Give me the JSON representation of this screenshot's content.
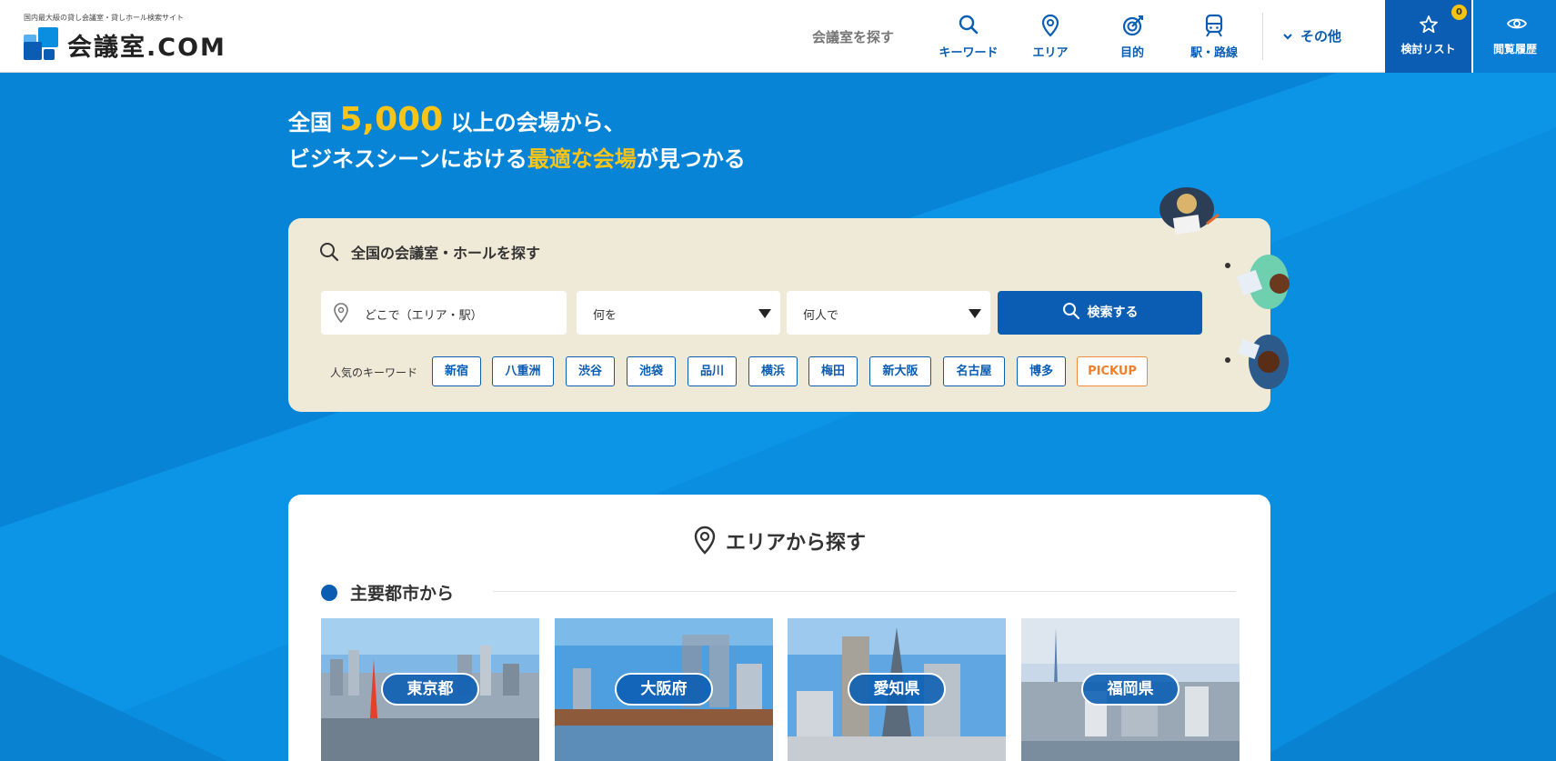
{
  "header": {
    "tagline": "国内最大級の貸し会議室・貸しホール検索サイト",
    "logo_text": "会議室.COM",
    "find_label": "会議室を探す",
    "nav": [
      {
        "label": "キーワード",
        "icon": "search-icon"
      },
      {
        "label": "エリア",
        "icon": "map-pin-icon"
      },
      {
        "label": "目的",
        "icon": "target-icon"
      },
      {
        "label": "駅・路線",
        "icon": "train-icon"
      }
    ],
    "other_label": "その他",
    "favorites_label": "検討リスト",
    "favorites_count": "0",
    "history_label": "閲覧履歴"
  },
  "hero": {
    "line1_prefix": "全国",
    "line1_number": "5,000",
    "line1_suffix": "以上の会場から、",
    "line2_prefix": "ビジネスシーンにおける",
    "line2_highlight": "最適な会場",
    "line2_suffix": "が見つかる"
  },
  "search": {
    "title": "全国の会議室・ホールを探す",
    "where_placeholder": "どこで（エリア・駅）",
    "what_placeholder": "何を",
    "people_placeholder": "何人で",
    "button_label": "検索する",
    "keywords_label": "人気のキーワード",
    "keywords": [
      "新宿",
      "八重洲",
      "渋谷",
      "池袋",
      "品川",
      "横浜",
      "梅田",
      "新大阪",
      "名古屋",
      "博多"
    ],
    "pickup_label": "PICKUP"
  },
  "area": {
    "title": "エリアから探す",
    "subheading": "主要都市から",
    "cities": [
      "東京都",
      "大阪府",
      "愛知県",
      "福岡県"
    ]
  },
  "colors": {
    "primary": "#0a5db3",
    "hero_blue": "#0a8ee0",
    "accent_yellow": "#f9c418",
    "panel_beige": "#efe9d8",
    "pickup_orange": "#f07f2a"
  }
}
